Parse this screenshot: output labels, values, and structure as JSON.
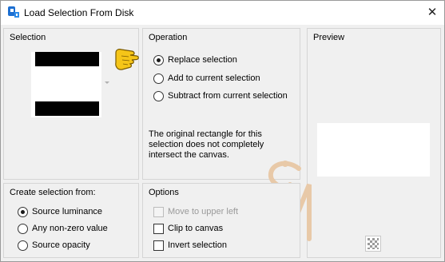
{
  "window": {
    "title": "Load Selection From Disk",
    "close_glyph": "✕"
  },
  "selection": {
    "heading": "Selection",
    "thumbnail": "black-white-horizontal-stripes"
  },
  "operation": {
    "heading": "Operation",
    "options": [
      {
        "label": "Replace selection",
        "selected": true
      },
      {
        "label": "Add to current selection",
        "selected": false
      },
      {
        "label": "Subtract from current selection",
        "selected": false
      }
    ],
    "note": "The original rectangle for this selection does not completely intersect the canvas."
  },
  "preview": {
    "heading": "Preview",
    "checker_icon": "checkerboard-icon"
  },
  "create_from": {
    "heading": "Create selection from:",
    "options": [
      {
        "label": "Source luminance",
        "selected": true
      },
      {
        "label": "Any non-zero value",
        "selected": false
      },
      {
        "label": "Source opacity",
        "selected": false
      }
    ]
  },
  "options": {
    "heading": "Options",
    "items": [
      {
        "label": "Move to upper left",
        "checked": false,
        "enabled": false
      },
      {
        "label": "Clip to canvas",
        "checked": false,
        "enabled": true
      },
      {
        "label": "Invert selection",
        "checked": false,
        "enabled": true
      }
    ]
  },
  "colors": {
    "accent_hand": "#f5c518",
    "watermark": "#e8c9a8"
  }
}
